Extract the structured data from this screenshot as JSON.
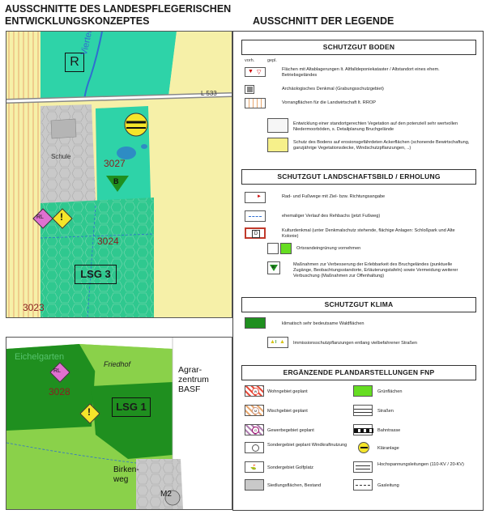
{
  "titles": {
    "left_line1": "AUSSCHNITTE DES LANDESPFLEGERISCHEN",
    "left_line2": "ENTWICKLUNGSKONZEPTES",
    "right": "AUSSCHNITT DER LEGENDE"
  },
  "map_top": {
    "labels": {
      "r_box": "R",
      "viertelbach": "Viertelbach",
      "road": "L 533",
      "schule": "Schule",
      "b_marker": "B",
      "rl_marker": "RL",
      "excl": "!",
      "lsg3": "LSG 3",
      "n3027": "3027",
      "n3024": "3024",
      "n3023": "3023"
    }
  },
  "map_bottom": {
    "labels": {
      "eichelgarten": "Eichelgarten",
      "rl_marker": "RL",
      "n3028": "3028",
      "friedhof": "Friedhof",
      "agrar1": "Agrar-",
      "agrar2": "zentrum",
      "agrar3": "BASF",
      "lsg1": "LSG 1",
      "excl": "!",
      "birken1": "Birken-",
      "birken2": "weg",
      "m2": "M2"
    }
  },
  "legend": {
    "boden": {
      "heading": "SCHUTZGUT BODEN",
      "col_vorh": "vorh.",
      "col_gepl": "gepl.",
      "items": [
        "Flächen mit Altablagerungen lt. Altfalldeponiekataster / Altstandort eines ehem. Betriebsgeländes",
        "Archäologisches Denkmal (Grabungsschutzgebiet)",
        "Vorrangflächen für die Landwirtschaft lt. RROP",
        "Entwicklung einer standortgerechten Vegetation auf den potenziell sehr wertvollen Niedermoorböden, s. Detailplanung Bruchgelände",
        "Schutz des Bodens auf erosionsgefährdeten Ackerflächen (schonende Bewirtschaftung, ganzjährige Vegetationsdecke, Windschutzpflanzungen, ..)"
      ]
    },
    "landschaft": {
      "heading": "SCHUTZGUT LANDSCHAFTSBILD / ERHOLUNG",
      "items": [
        "Rad- und Fußwege mit Ziel- bzw. Richtungsangabe",
        "ehemaliger Verlauf des Rehbachs (jetzt Fußweg)",
        "Kulturdenkmal (unter Denkmalschutz stehende, flächige Anlagen: Schloßpark und Alte Kolonie)",
        "Ortsrandeingrünung vornehmen",
        "Maßnahmen zur Verbesserung der Erlebbarkeit des Bruchgeländes (punktuelle Zugänge, Beobachtungsstandorte, Erläuterungstafeln) sowie Vermeidung weiterer Verbuschung  (Maßnahmen zur Offenhaltung)"
      ],
      "d_symbol": "D",
      "b_symbol": "B"
    },
    "klima": {
      "heading": "SCHUTZGUT KLIMA",
      "items": [
        "klimatisch sehr bedeutsame Waldflächen",
        "Immissionsschutzpflanzungen entlang vielbefahrener Straßen"
      ],
      "i_symbol": "I"
    },
    "fnp": {
      "heading": "ERGÄNZENDE PLANDARSTELLUNGEN FNP",
      "left": [
        "Wohngebiet geplant",
        "Mischgebiet geplant",
        "Gewerbegebiet geplant",
        "Sondergebiet geplant Windkraftnutzung",
        "Sondergebiet Golfplatz",
        "Siedlungsflächen, Bestand"
      ],
      "right": [
        "Grünflächen",
        "Straßen",
        "Bahntrasse",
        "Kläranlage",
        "Hochspannungsleitungen (110-KV / 20-KV)",
        "Gasleitung"
      ],
      "sym_w": "W",
      "sym_m": "M",
      "sym_g": "G"
    }
  },
  "colors": {
    "turquoise": "#2ed3a8",
    "meadow": "#2fc88f",
    "dark_green": "#1f8f1f",
    "mid_green": "#34a830",
    "light_green": "#8ad14a",
    "bright_green": "#66dd22",
    "yellow_field": "#f6f0a8",
    "orange_field": "#f2c27a",
    "settlement": "#c9c9c9",
    "magenta": "#e070d0"
  }
}
